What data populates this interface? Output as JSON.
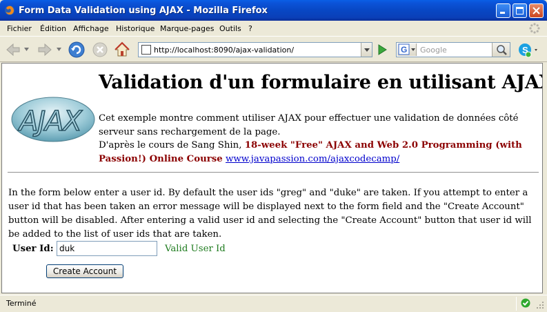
{
  "window": {
    "title": "Form Data Validation using AJAX - Mozilla Firefox",
    "app_icon": "firefox-icon"
  },
  "menu": [
    "Fichier",
    "Édition",
    "Affichage",
    "Historique",
    "Marque-pages",
    "Outils",
    "?"
  ],
  "toolbar": {
    "url": "http://localhost:8090/ajax-validation/",
    "search_placeholder": "Google",
    "search_engine_icon": "google-icon"
  },
  "page": {
    "logo_text": "AJAX",
    "heading": "Validation d'un formulaire en utilisant AJAX",
    "intro_line1": "Cet exemple montre comment utiliser AJAX pour effectuer une validation de données côté serveur sans rechargement de la page.",
    "intro_line2_prefix": "D'après le cours de Sang Shin, ",
    "intro_course": "18-week \"Free\" AJAX and Web 2.0 Programming (with Passion!) Online Course",
    "intro_link": "www.javapassion.com/ajaxcodecamp/",
    "description": "In the form below enter a user id. By default the user ids \"greg\" and \"duke\" are taken. If you attempt to enter a user id that has been taken an error message will be displayed next to the form field and the \"Create Account\" button will be disabled. After entering a valid user id and selecting the \"Create Account\" button that user id will be added to the list of user ids that are taken.",
    "form": {
      "label": "User Id:",
      "value": "duk",
      "validation_message": "Valid User Id",
      "validation_color": "#1E7B1E",
      "submit_label": "Create Account"
    }
  },
  "status": {
    "text": "Terminé"
  },
  "colors": {
    "titlebar": "#0A4FD0",
    "course_text": "#8B0000",
    "link": "#0000CC"
  }
}
